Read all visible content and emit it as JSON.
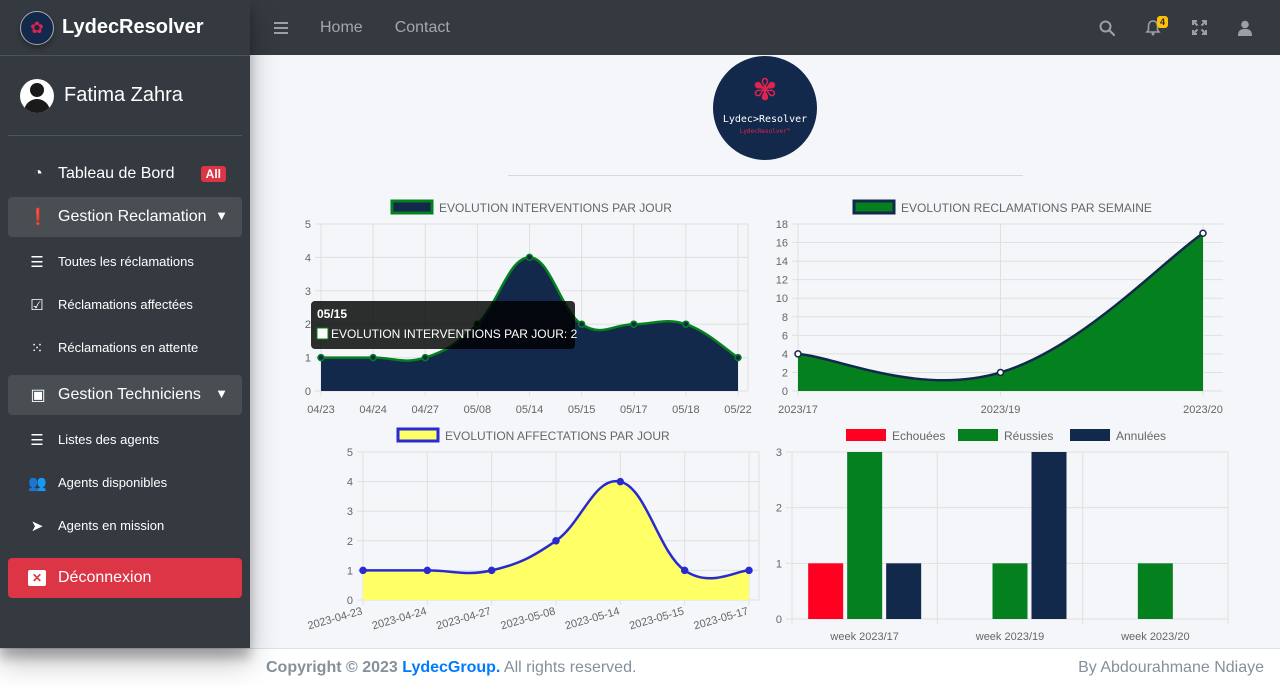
{
  "brand": {
    "name": "LydecResolver"
  },
  "user": {
    "name": "Fatima Zahra"
  },
  "sidebar": {
    "dashboard": {
      "label": "Tableau de Bord",
      "badge": "All"
    },
    "reclamation": {
      "label": "Gestion Reclamation",
      "items": [
        {
          "label": "Toutes les réclamations",
          "icon": "list-icon"
        },
        {
          "label": "Réclamations affectées",
          "icon": "check-square-icon"
        },
        {
          "label": "Réclamations en attente",
          "icon": "spinner-icon"
        }
      ]
    },
    "techniciens": {
      "label": "Gestion Techniciens",
      "items": [
        {
          "label": "Listes des agents",
          "icon": "list-icon"
        },
        {
          "label": "Agents disponibles",
          "icon": "users-icon"
        },
        {
          "label": "Agents en mission",
          "icon": "paper-plane-icon"
        }
      ]
    },
    "logout": {
      "label": "Déconnexion"
    }
  },
  "topbar": {
    "links": [
      "Home",
      "Contact"
    ],
    "notifications_count": "4"
  },
  "logo": {
    "text": "Lydec>Resolver",
    "subtext": "LydecResolver™"
  },
  "tooltip": {
    "title": "05/15",
    "body": "EVOLUTION INTERVENTIONS PAR JOUR: 2"
  },
  "footer": {
    "copyright": "Copyright © 2023 ",
    "company": "LydecGroup.",
    "rights": " All rights reserved.",
    "author": "By Abdourahmane Ndiaye"
  },
  "colors": {
    "navy": "#13294b",
    "green": "#04801f",
    "yellow": "#ffff66",
    "red": "#ff0021",
    "danger": "#dc3545"
  },
  "chart_data": [
    {
      "type": "area",
      "title": "",
      "legend": [
        "EVOLUTION INTERVENTIONS PAR JOUR"
      ],
      "x": [
        "04/23",
        "04/24",
        "04/27",
        "05/08",
        "05/14",
        "05/15",
        "05/17",
        "05/18",
        "05/22"
      ],
      "series": [
        {
          "name": "EVOLUTION INTERVENTIONS PAR JOUR",
          "values": [
            1,
            1,
            1,
            2,
            4,
            2,
            2,
            2,
            1
          ]
        }
      ],
      "ylim": [
        0,
        5
      ],
      "yticks": [
        0,
        1,
        2,
        3,
        4,
        5
      ],
      "fill": "#13294b",
      "line": "#04801f",
      "grid": true,
      "legend_position": "top"
    },
    {
      "type": "area",
      "title": "",
      "legend": [
        "EVOLUTION RECLAMATIONS PAR SEMAINE"
      ],
      "x": [
        "2023/17",
        "2023/19",
        "2023/20"
      ],
      "series": [
        {
          "name": "EVOLUTION RECLAMATIONS PAR SEMAINE",
          "values": [
            4,
            2,
            17
          ]
        }
      ],
      "ylim": [
        0,
        18
      ],
      "yticks": [
        0,
        2,
        4,
        6,
        8,
        10,
        12,
        14,
        16,
        18
      ],
      "fill": "#04801f",
      "line": "#13294b",
      "grid": true,
      "legend_position": "top"
    },
    {
      "type": "area",
      "title": "",
      "legend": [
        "EVOLUTION AFFECTATIONS PAR JOUR"
      ],
      "x": [
        "2023-04-23",
        "2023-04-24",
        "2023-04-27",
        "2023-05-08",
        "2023-05-14",
        "2023-05-15",
        "2023-05-17"
      ],
      "series": [
        {
          "name": "EVOLUTION AFFECTATIONS PAR JOUR",
          "values": [
            1,
            1,
            1,
            2,
            4,
            1,
            1
          ]
        }
      ],
      "ylim": [
        0,
        5
      ],
      "yticks": [
        0,
        1,
        2,
        3,
        4,
        5
      ],
      "fill": "#ffff66",
      "line": "#2a2ad1",
      "grid": true,
      "legend_position": "top"
    },
    {
      "type": "bar",
      "title": "",
      "categories": [
        "week 2023/17",
        "week 2023/19",
        "week 2023/20"
      ],
      "series": [
        {
          "name": "Echouées",
          "values": [
            1,
            0,
            0
          ],
          "color": "#ff0021"
        },
        {
          "name": "Réussies",
          "values": [
            3,
            1,
            1
          ],
          "color": "#04801f"
        },
        {
          "name": "Annulées",
          "values": [
            1,
            3,
            0
          ],
          "color": "#13294b"
        }
      ],
      "ylim": [
        0,
        3
      ],
      "yticks": [
        0,
        1,
        2,
        3
      ],
      "grid": true,
      "legend_position": "top"
    }
  ]
}
